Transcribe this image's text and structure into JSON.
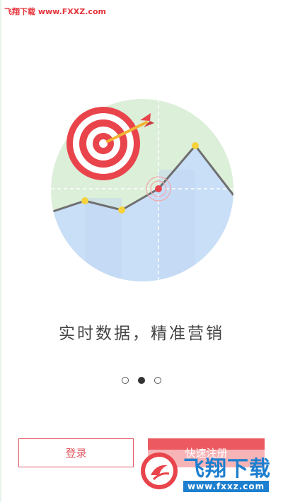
{
  "watermark_top": "飞翔下载 www.FXXZ.com",
  "slogan": "实时数据，精准营销",
  "pager": {
    "count": 3,
    "active_index": 1
  },
  "buttons": {
    "login_label": "登录",
    "register_label": "快速注册"
  },
  "site_logo": {
    "name": "飞翔下载",
    "url": "www.fxxz.com"
  },
  "colors": {
    "accent_red": "#ec5960",
    "target_red": "#e9444b",
    "chart_fill_blue": "#c9def7",
    "circle_green": "#dcefd9",
    "point_yellow": "#f5d23c",
    "logo_blue": "#1d7fcf"
  },
  "icons": [
    "target-icon",
    "arrow-icon",
    "line-chart-illustration",
    "site-logo-badge-icon"
  ]
}
